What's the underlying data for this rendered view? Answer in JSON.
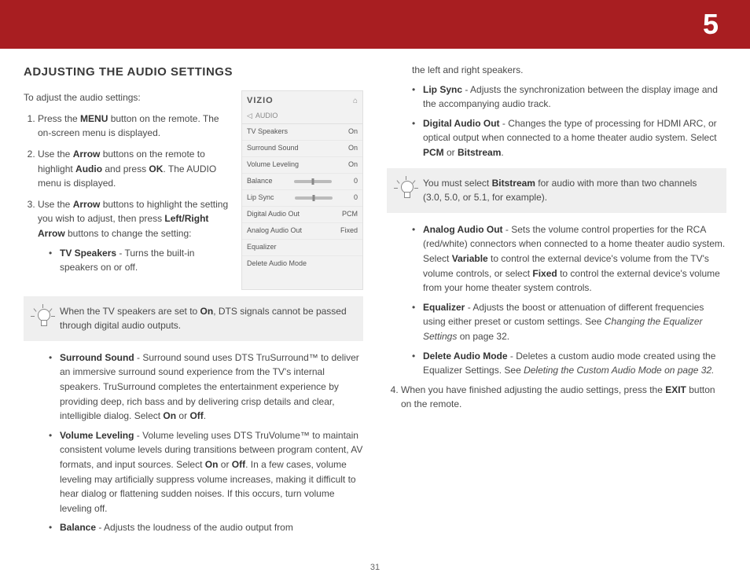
{
  "chapter": "5",
  "pageNumber": "31",
  "heading": "ADJUSTING THE AUDIO SETTINGS",
  "intro": "To adjust the audio settings:",
  "step1": {
    "pre": "Press the ",
    "b1": "MENU",
    "post": " button on the remote. The on-screen menu is displayed."
  },
  "step2": {
    "pre": "Use the ",
    "b1": "Arrow",
    "mid1": " buttons on the remote to highlight ",
    "b2": "Audio",
    "mid2": " and press ",
    "b3": "OK",
    "post": ". The AUDIO menu is displayed."
  },
  "step3": {
    "pre": "Use the ",
    "b1": "Arrow",
    "mid1": " buttons to highlight the setting you wish to adjust, then press ",
    "b2": "Left/Right Arrow",
    "post": " buttons to change the setting:"
  },
  "step4": {
    "pre": "When you have finished adjusting the audio settings, press the ",
    "b1": "EXIT",
    "post": " button on the remote."
  },
  "tvSpeakers": {
    "label": "TV Speakers",
    "desc": " - Turns the built-in speakers on or off."
  },
  "tip1": {
    "pre": "When the TV speakers are set to ",
    "b1": "On",
    "post": ", DTS signals cannot be passed through digital audio outputs."
  },
  "surround": {
    "label": "Surround Sound",
    "mid1": " - Surround sound uses DTS TruSurround™ to deliver an immersive surround sound experience from the TV's internal speakers. TruSurround completes the entertainment experience by providing deep, rich bass and by delivering crisp details and clear, intelligible dialog. Select ",
    "b1": "On",
    "or": " or ",
    "b2": "Off",
    "end": "."
  },
  "volume": {
    "label": "Volume Leveling",
    "mid1": " - Volume leveling uses DTS TruVolume™ to maintain consistent volume levels during transitions between program content, AV formats, and input sources. Select ",
    "b1": "On",
    "or": " or ",
    "b2": "Off",
    "post": ". In a few cases, volume leveling may artificially suppress volume increases, making it difficult to hear dialog or flattening sudden noises. If this occurs, turn volume leveling off."
  },
  "balance": {
    "label": "Balance",
    "desc": " - Adjusts the loudness of the audio output from "
  },
  "balanceCont": "the left and right speakers.",
  "lipSync": {
    "label": "Lip Sync",
    "desc": " - Adjusts the synchronization between the display image and the accompanying audio track."
  },
  "digital": {
    "label": "Digital Audio Out",
    "mid1": " - Changes the type of processing for HDMI ARC, or optical output when connected to a home theater audio system. Select ",
    "b1": "PCM",
    "or": " or ",
    "b2": "Bitstream",
    "end": "."
  },
  "tip2": {
    "pre": "You must select ",
    "b1": "Bitstream",
    "post": " for audio with more than two channels (3.0, 5.0, or 5.1, for example)."
  },
  "analog": {
    "label": "Analog Audio Out",
    "mid1": " - Sets the volume control properties for the RCA (red/white) connectors when connected to a home theater audio system. Select ",
    "b1": "Variable",
    "mid2": " to control the external device's volume from the TV's volume controls, or select ",
    "b2": "Fixed",
    "post": " to control the external device's volume from your home theater system controls."
  },
  "equalizer": {
    "label": "Equalizer",
    "desc": " - Adjusts the boost or attenuation of different frequencies using either preset or custom settings. See ",
    "ref": "Changing the Equalizer Settings",
    "post": " on page 32."
  },
  "deleteMode": {
    "label": "Delete Audio Mode",
    "desc": " - Deletes a custom audio mode created using the Equalizer Settings. See ",
    "ref": "Deleting the Custom Audio Mode on page 32."
  },
  "menu": {
    "brand": "VIZIO",
    "section": "AUDIO",
    "rows": [
      {
        "label": "TV Speakers",
        "value": "On"
      },
      {
        "label": "Surround Sound",
        "value": "On"
      },
      {
        "label": "Volume Leveling",
        "value": "On"
      },
      {
        "label": "Balance",
        "value": "0",
        "slider": true
      },
      {
        "label": "Lip Sync",
        "value": "0",
        "slider": true
      },
      {
        "label": "Digital Audio Out",
        "value": "PCM"
      },
      {
        "label": "Analog Audio Out",
        "value": "Fixed"
      },
      {
        "label": "Equalizer",
        "value": ""
      },
      {
        "label": "Delete Audio Mode",
        "value": ""
      }
    ]
  }
}
